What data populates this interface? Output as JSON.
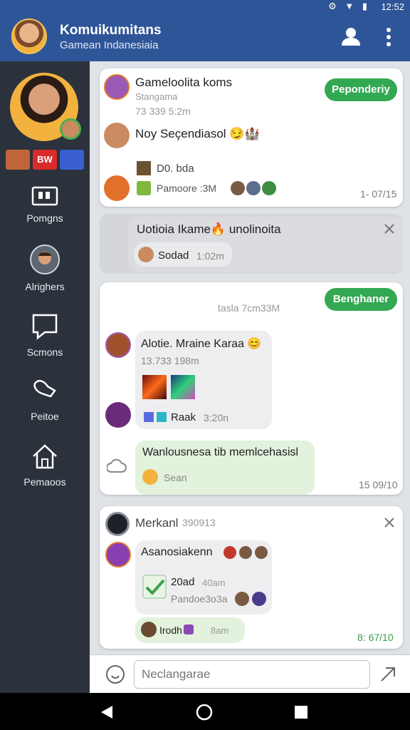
{
  "status": {
    "time": "12:52",
    "icons": "⚙ ▼ ▮"
  },
  "app": {
    "title": "Komuikumitans",
    "subtitle": "Gamean Indanesiaia"
  },
  "sidebar": {
    "badges": [
      "",
      "BW",
      ""
    ],
    "items": [
      {
        "label": "Pomgns",
        "icon": "calendar-icon"
      },
      {
        "label": "Alrighers",
        "icon": "avatar-icon"
      },
      {
        "label": "Scmons",
        "icon": "chat-icon"
      },
      {
        "label": "Peitoe",
        "icon": "cursor-hand-icon"
      },
      {
        "label": "Pemaoos",
        "icon": "home-icon"
      }
    ]
  },
  "cards": [
    {
      "header": "Gameloolita koms",
      "subheader": "Stangama",
      "meta": "73 339 5:2m",
      "button": "Peponderiy",
      "message": "Noy Seçendiasol 😏🏰",
      "file_name": "D0. bda",
      "file_meta": "Pamoore :3M",
      "timestamp": "1- 07/15"
    },
    {
      "title": "Uotioia Ikame🔥 unolinoita",
      "reply": "Sodad",
      "reply_time": "1:02m"
    },
    {
      "button": "Benghaner",
      "meta": "tasla 7cm33M",
      "message": "Alotie. Mraine Karaa 😊",
      "sub": "13.733 198m",
      "reaction": "Raak",
      "reaction_time": "3:20n",
      "green_message": "Wanlousnesa tib memlcehasisl",
      "green_sub": "Sean",
      "timestamp": "15 09/10"
    },
    {
      "header": "Merkanl",
      "header_meta": "390913",
      "message": "Asanosiakenn",
      "attach_title": "20ad",
      "attach_time": "40am",
      "attach_sub": "Pandoe3o3a",
      "reply": "Irodh",
      "reply_time": "8am",
      "timestamp": "8: 67/10"
    }
  ],
  "input": {
    "placeholder": "Neclangarae"
  },
  "colors": {
    "primary": "#2f5599",
    "accent": "#33a852",
    "sidebar": "#2b323c"
  }
}
